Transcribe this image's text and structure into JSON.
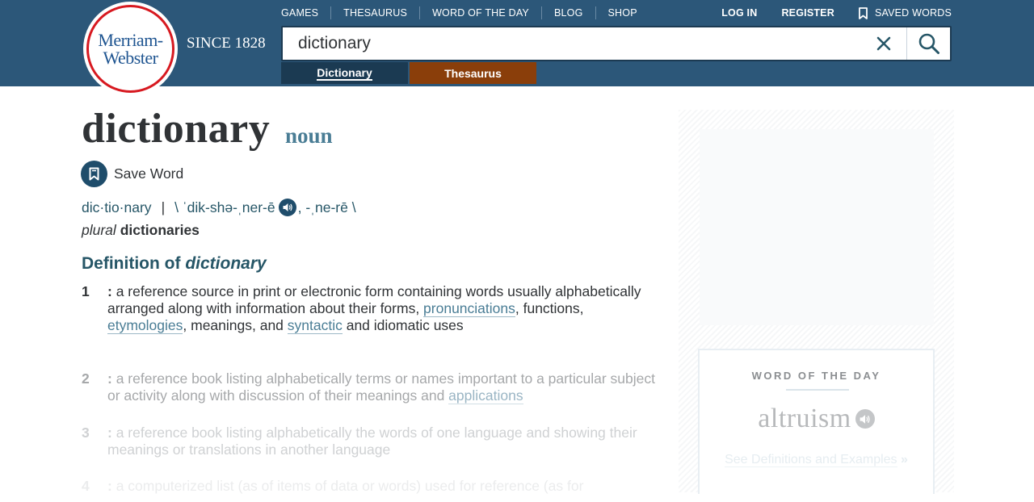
{
  "header": {
    "logo": {
      "line1": "Merriam-",
      "line2": "Webster"
    },
    "since": "SINCE 1828",
    "nav": [
      "GAMES",
      "THESAURUS",
      "WORD OF THE DAY",
      "BLOG",
      "SHOP"
    ],
    "user_nav": {
      "login": "LOG IN",
      "register": "REGISTER",
      "saved_words": "SAVED WORDS"
    },
    "search": {
      "value": "dictionary"
    },
    "tabs": {
      "dictionary": "Dictionary",
      "thesaurus": "Thesaurus"
    },
    "colors": {
      "header_bg": "#2c5779",
      "dictionary_tab": "#1b3a52",
      "thesaurus_tab": "#8a3e0a",
      "logo_red": "#d71920",
      "logo_blue": "#1f5591"
    }
  },
  "entry": {
    "headword": "dictionary",
    "part_of_speech": "noun",
    "save_word": "Save Word",
    "syllables": "dic·tio·nary",
    "pron_sep": "|",
    "pron_open": "\\ ˈdik-shə-ˌner-ē",
    "pron_alt": ", -ˌne-rē \\",
    "plural_label": "plural",
    "plural_word": "dictionaries",
    "definition_heading_prefix": "Definition of",
    "definition_heading_word": "dictionary",
    "senses": [
      {
        "num": "1",
        "colon": ":",
        "t1": " a reference source in print or electronic form containing words usually alphabetically arranged along with information about their forms, ",
        "l1": "pronunciations",
        "t2": ", functions, ",
        "l2": "etymologies",
        "t3": ", meanings, and ",
        "l3": "syntactic",
        "t4": " and idiomatic uses"
      },
      {
        "num": "2",
        "colon": ":",
        "t1": " a reference book listing alphabetically terms or names important to a particular subject or activity along with discussion of their meanings and ",
        "l1": "applications"
      },
      {
        "num": "3",
        "colon": ":",
        "t1": " a reference book listing alphabetically the words of one language and showing their meanings or translations in another language"
      },
      {
        "num": "4",
        "colon": ":",
        "t1": " a computerized list (as of items of data or words) used for reference (as for"
      }
    ]
  },
  "sidebar": {
    "word_of_the_day": {
      "title": "WORD OF THE DAY",
      "word": "altruism",
      "link": "See Definitions and Examples",
      "link_arrow": "»"
    }
  },
  "icons": [
    "close-icon",
    "search-icon",
    "bookmark-icon",
    "speaker-icon"
  ]
}
